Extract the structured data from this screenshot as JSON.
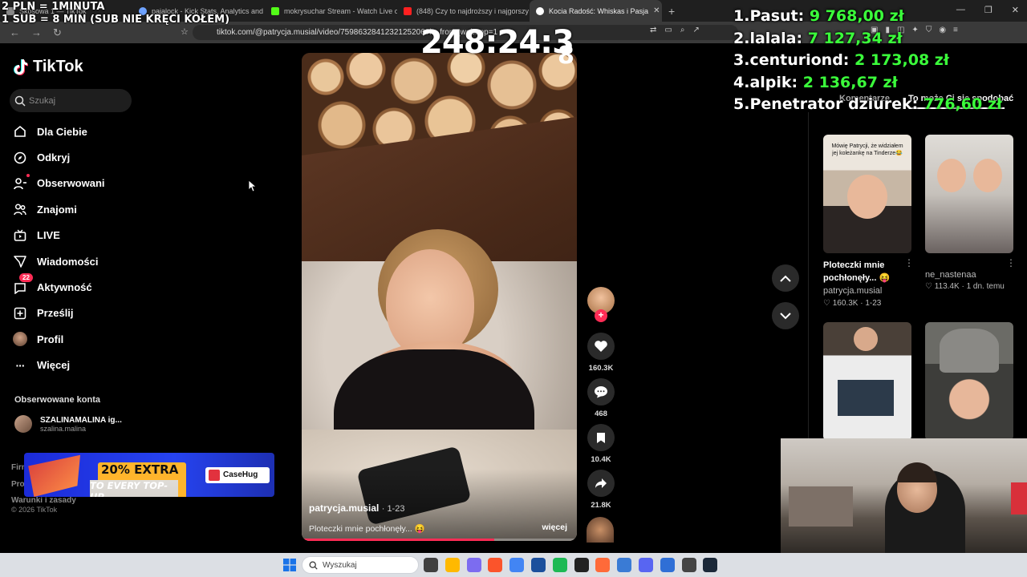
{
  "browser": {
    "tabs": [
      {
        "label": "Skosowa 1 — TikTok",
        "icon_color": "#888888"
      },
      {
        "label": "pajalock - Kick Stats, Analytics and Ch",
        "icon_color": "#6ea2ff"
      },
      {
        "label": "mokrysuchar Stream - Watch Live on",
        "icon_color": "#53fc18"
      },
      {
        "label": "(848) Czy to najdroższy i najgorszy m",
        "icon_color": "#ff2020"
      },
      {
        "label": "Kocia Radość: Whiskas i Pasja",
        "icon_color": "#ffffff",
        "active": true
      }
    ],
    "new_tab": "+",
    "url": "tiktok.com/@patrycja.musial/video/7598632841232125206?is_from_webapp=1"
  },
  "overlay": {
    "rate_line1": "2 PLN = 1MINUTA",
    "rate_line2": "1 SUB = 8 MIN (SUB NIE KRĘCI KOŁEM)",
    "timer": "248:24:3",
    "timer_tail": "8",
    "leaderboard": [
      {
        "rank": "1.",
        "name": "Pasut:",
        "amount": "9 768,00 zł"
      },
      {
        "rank": "2.",
        "name": "lalala:",
        "amount": "7 127,34 zł"
      },
      {
        "rank": "3.",
        "name": "centuriond:",
        "amount": "2 173,08 zł"
      },
      {
        "rank": "4.",
        "name": "alpik:",
        "amount": "2 136,67 zł"
      },
      {
        "rank": "5.",
        "name": "Penetrator dziurek:",
        "amount": "776,60 zł"
      }
    ]
  },
  "sidebar": {
    "logo": "TikTok",
    "search_placeholder": "Szukaj",
    "items": [
      {
        "label": "Dla Ciebie",
        "icon": "home-icon"
      },
      {
        "label": "Odkryj",
        "icon": "compass-icon"
      },
      {
        "label": "Obserwowani",
        "icon": "following-icon"
      },
      {
        "label": "Znajomi",
        "icon": "friends-icon"
      },
      {
        "label": "LIVE",
        "icon": "live-icon"
      },
      {
        "label": "Wiadomości",
        "icon": "messages-icon"
      },
      {
        "label": "Aktywność",
        "icon": "activity-icon",
        "badge": "22"
      },
      {
        "label": "Prześlij",
        "icon": "upload-icon"
      },
      {
        "label": "Profil",
        "icon": "profile-avatar-icon"
      },
      {
        "label": "Więcej",
        "icon": "more-icon"
      }
    ],
    "followed_heading": "Obserwowane konta",
    "followed_account": {
      "name": "SZALINAMALINA ig...",
      "handle": "szalina.malina"
    },
    "footer_links": [
      "Firma",
      "Program",
      "Warunki i zasady"
    ],
    "copyright": "© 2026 TikTok"
  },
  "ad": {
    "headline": "20% EXTRA",
    "subline": "TO EVERY TOP-UP",
    "brand": "CaseHug"
  },
  "video": {
    "username": "patrycja.musial",
    "date": "· 1-23",
    "caption": "Ploteczki mnie pochłonęły... 😝",
    "more": "więcej",
    "progress": 0.7
  },
  "actions": {
    "likes": "160.3K",
    "comments": "468",
    "saves": "10.4K",
    "shares": "21.8K"
  },
  "right_panel": {
    "tab_comments": "Komentarze",
    "tab_suggested": "To może Ci się spodobać",
    "items": [
      {
        "caption": "Mówię Patrycji, że widziałem jej koleżankę na Tinderze😂",
        "title_line1": "Ploteczki mnie",
        "title_line2": "pochłonęły... 😝",
        "user": "patrycja.musial",
        "likes": "♡ 160.3K",
        "date": "· 1-23"
      },
      {
        "title_line1": "",
        "title_line2": "",
        "user": "ne_nastenaa",
        "likes": "♡ 113.4K",
        "date": "· 1 dn. temu"
      }
    ]
  },
  "taskbar": {
    "search_placeholder": "Wyszukaj",
    "app_colors": [
      "#404040",
      "#ffb900",
      "#7c6cf0",
      "#fb542b",
      "#4285f4",
      "#1b4f9c",
      "#1db954",
      "#222222",
      "#ff6a39",
      "#3a7bd5",
      "#5865f2",
      "#2f6fd6",
      "#444444",
      "#1b2838"
    ]
  }
}
